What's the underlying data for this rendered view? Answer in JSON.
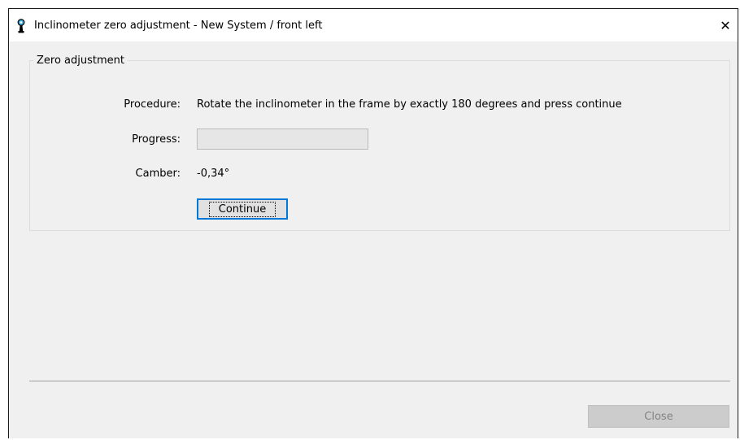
{
  "window": {
    "title": "Inclinometer zero adjustment - New System / front left",
    "icon": "inclinometer-app-icon",
    "close_glyph": "✕"
  },
  "group": {
    "legend": "Zero adjustment",
    "procedure_label": "Procedure:",
    "procedure_text": "Rotate the inclinometer in the frame by exactly 180 degrees and press continue",
    "progress_label": "Progress:",
    "progress_value": 0,
    "camber_label": "Camber:",
    "camber_value": "-0,34°",
    "continue_label": "Continue"
  },
  "footer": {
    "close_label": "Close",
    "close_enabled": false
  },
  "colors": {
    "window_bg": "#f0f0f0",
    "titlebar_bg": "#ffffff",
    "focus_border": "#0078d7",
    "disabled_text": "#838383"
  }
}
